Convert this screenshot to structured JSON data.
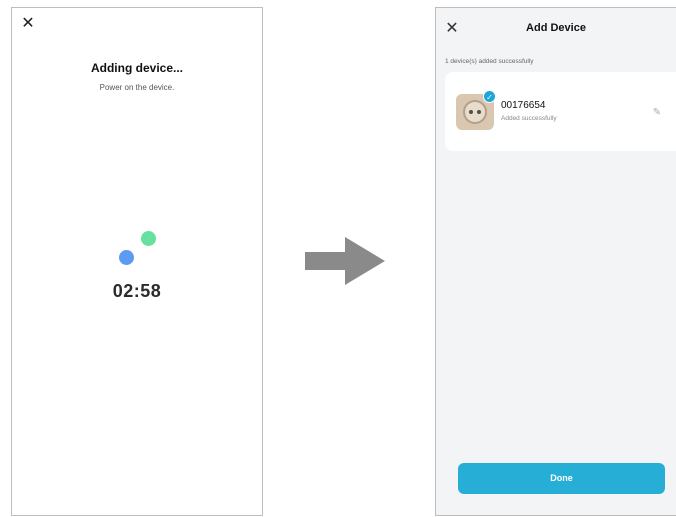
{
  "left_screen": {
    "close_glyph": "✕",
    "title": "Adding device...",
    "subtitle": "Power on the device.",
    "timer": "02:58",
    "colors": {
      "dot_blue": "#5b9bf2",
      "dot_green": "#66e09f"
    }
  },
  "arrow": {
    "icon": "arrow-right-icon",
    "color": "#8a8a8a"
  },
  "right_screen": {
    "close_glyph": "✕",
    "title": "Add Device",
    "status_line": "1 device(s) added successfully",
    "device": {
      "name": "00176654",
      "status": "Added successfully",
      "badge_glyph": "✓",
      "edit_glyph": "✎"
    },
    "done_label": "Done",
    "colors": {
      "accent": "#27aed6"
    }
  }
}
